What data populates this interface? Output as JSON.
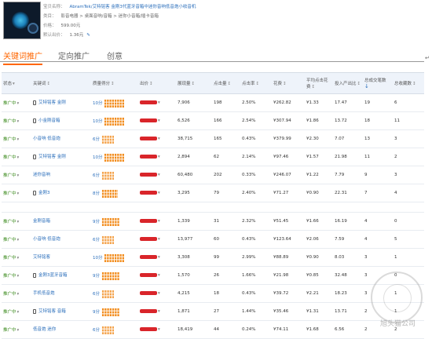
{
  "product": {
    "title_label": "宝贝名称：",
    "title": "AbramTek/艾特铭客 金刚3代蓝牙音箱中迷你音响低音炮小收音机",
    "category_label": "类目：",
    "category": "影音电器 > 桌面音响/音箱 > 迷你小音箱/插卡音箱",
    "price_label": "价格：",
    "price": "599.00元",
    "bid_label": "默认出价：",
    "bid": "1.36元"
  },
  "tabs": [
    {
      "label": "关键词推广",
      "active": true
    },
    {
      "label": "定向推广",
      "active": false
    },
    {
      "label": "创意",
      "active": false
    }
  ],
  "table": {
    "headers": [
      "状态",
      "关键词",
      "质量得分",
      "出价",
      "展现量",
      "点击量",
      "点击率",
      "花费",
      "平均点击花费",
      "投入产出比",
      "总成交笔数",
      "总收藏数"
    ],
    "rows": [
      {
        "status": "推广中",
        "mobile": true,
        "keyword": "艾特铭客 金刚",
        "qs": "10分",
        "qs_fill": 1.0,
        "impr": "7,906",
        "clicks": "198",
        "ctr": "2.50%",
        "cost": "¥262.82",
        "cpc": "¥1.33",
        "roi": "17.47",
        "orders": "19",
        "favs": "6"
      },
      {
        "status": "推广中",
        "mobile": true,
        "keyword": "小金刚音箱",
        "qs": "10分",
        "qs_fill": 1.0,
        "impr": "6,526",
        "clicks": "166",
        "ctr": "2.54%",
        "cost": "¥307.94",
        "cpc": "¥1.86",
        "roi": "13.72",
        "orders": "18",
        "favs": "11"
      },
      {
        "status": "推广中",
        "mobile": false,
        "keyword": "小音响 低音炮",
        "qs": "6分",
        "qs_fill": 0.6,
        "impr": "38,715",
        "clicks": "165",
        "ctr": "0.43%",
        "cost": "¥379.99",
        "cpc": "¥2.30",
        "roi": "7.07",
        "orders": "13",
        "favs": "3"
      },
      {
        "status": "推广中",
        "mobile": true,
        "keyword": "艾特铭客 金刚",
        "qs": "10分",
        "qs_fill": 1.0,
        "impr": "2,894",
        "clicks": "62",
        "ctr": "2.14%",
        "cost": "¥97.46",
        "cpc": "¥1.57",
        "roi": "21.98",
        "orders": "11",
        "favs": "2"
      },
      {
        "status": "推广中",
        "mobile": false,
        "keyword": "迷你音响",
        "qs": "6分",
        "qs_fill": 0.6,
        "impr": "60,480",
        "clicks": "202",
        "ctr": "0.33%",
        "cost": "¥246.07",
        "cpc": "¥1.22",
        "roi": "7.79",
        "orders": "9",
        "favs": "3"
      },
      {
        "status": "推广中",
        "mobile": true,
        "keyword": "金刚3",
        "qs": "8分",
        "qs_fill": 0.8,
        "impr": "3,295",
        "clicks": "79",
        "ctr": "2.40%",
        "cost": "¥71.27",
        "cpc": "¥0.90",
        "roi": "22.31",
        "orders": "7",
        "favs": "4"
      },
      {
        "status": "推广中",
        "mobile": false,
        "keyword": "金刚音箱",
        "qs": "9分",
        "qs_fill": 0.9,
        "impr": "1,339",
        "clicks": "31",
        "ctr": "2.32%",
        "cost": "¥51.45",
        "cpc": "¥1.66",
        "roi": "16.19",
        "orders": "4",
        "favs": "0"
      },
      {
        "status": "推广中",
        "mobile": false,
        "keyword": "小音响 低音炮",
        "qs": "6分",
        "qs_fill": 0.6,
        "impr": "13,977",
        "clicks": "60",
        "ctr": "0.43%",
        "cost": "¥123.64",
        "cpc": "¥2.06",
        "roi": "7.59",
        "orders": "4",
        "favs": "5"
      },
      {
        "status": "推广中",
        "mobile": false,
        "keyword": "艾特铭客",
        "qs": "10分",
        "qs_fill": 1.0,
        "impr": "3,308",
        "clicks": "99",
        "ctr": "2.99%",
        "cost": "¥88.89",
        "cpc": "¥0.90",
        "roi": "8.03",
        "orders": "3",
        "favs": "1"
      },
      {
        "status": "推广中",
        "mobile": true,
        "keyword": "金刚3蓝牙音箱",
        "qs": "9分",
        "qs_fill": 0.9,
        "impr": "1,570",
        "clicks": "26",
        "ctr": "1.66%",
        "cost": "¥21.98",
        "cpc": "¥0.85",
        "roi": "32.48",
        "orders": "3",
        "favs": "0"
      },
      {
        "status": "推广中",
        "mobile": false,
        "keyword": "手机低音炮",
        "qs": "6分",
        "qs_fill": 0.6,
        "impr": "4,215",
        "clicks": "18",
        "ctr": "0.43%",
        "cost": "¥39.72",
        "cpc": "¥2.21",
        "roi": "18.23",
        "orders": "3",
        "favs": "1"
      },
      {
        "status": "推广中",
        "mobile": true,
        "keyword": "艾特铭客 音箱",
        "qs": "9分",
        "qs_fill": 0.9,
        "impr": "1,871",
        "clicks": "27",
        "ctr": "1.44%",
        "cost": "¥35.46",
        "cpc": "¥1.31",
        "roi": "13.71",
        "orders": "2",
        "favs": "1"
      },
      {
        "status": "推广中",
        "mobile": false,
        "keyword": "低音炮 迷你",
        "qs": "6分",
        "qs_fill": 0.6,
        "impr": "18,419",
        "clicks": "44",
        "ctr": "0.24%",
        "cost": "¥74.11",
        "cpc": "¥1.68",
        "roi": "6.56",
        "orders": "2",
        "favs": "2"
      }
    ]
  },
  "watermark": "旭头猫公司"
}
